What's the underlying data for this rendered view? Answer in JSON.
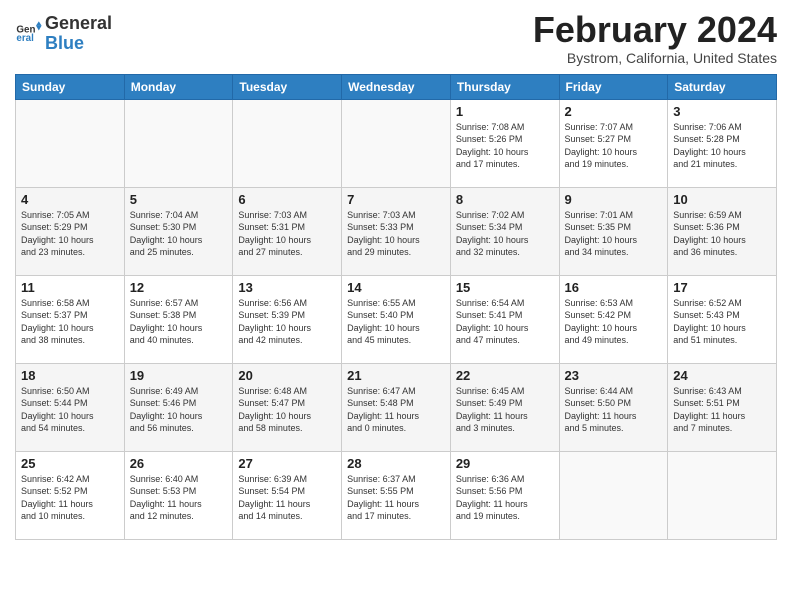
{
  "header": {
    "logo_general": "General",
    "logo_blue": "Blue",
    "month_title": "February 2024",
    "location": "Bystrom, California, United States"
  },
  "weekdays": [
    "Sunday",
    "Monday",
    "Tuesday",
    "Wednesday",
    "Thursday",
    "Friday",
    "Saturday"
  ],
  "weeks": [
    [
      {
        "day": "",
        "info": ""
      },
      {
        "day": "",
        "info": ""
      },
      {
        "day": "",
        "info": ""
      },
      {
        "day": "",
        "info": ""
      },
      {
        "day": "1",
        "info": "Sunrise: 7:08 AM\nSunset: 5:26 PM\nDaylight: 10 hours\nand 17 minutes."
      },
      {
        "day": "2",
        "info": "Sunrise: 7:07 AM\nSunset: 5:27 PM\nDaylight: 10 hours\nand 19 minutes."
      },
      {
        "day": "3",
        "info": "Sunrise: 7:06 AM\nSunset: 5:28 PM\nDaylight: 10 hours\nand 21 minutes."
      }
    ],
    [
      {
        "day": "4",
        "info": "Sunrise: 7:05 AM\nSunset: 5:29 PM\nDaylight: 10 hours\nand 23 minutes."
      },
      {
        "day": "5",
        "info": "Sunrise: 7:04 AM\nSunset: 5:30 PM\nDaylight: 10 hours\nand 25 minutes."
      },
      {
        "day": "6",
        "info": "Sunrise: 7:03 AM\nSunset: 5:31 PM\nDaylight: 10 hours\nand 27 minutes."
      },
      {
        "day": "7",
        "info": "Sunrise: 7:03 AM\nSunset: 5:33 PM\nDaylight: 10 hours\nand 29 minutes."
      },
      {
        "day": "8",
        "info": "Sunrise: 7:02 AM\nSunset: 5:34 PM\nDaylight: 10 hours\nand 32 minutes."
      },
      {
        "day": "9",
        "info": "Sunrise: 7:01 AM\nSunset: 5:35 PM\nDaylight: 10 hours\nand 34 minutes."
      },
      {
        "day": "10",
        "info": "Sunrise: 6:59 AM\nSunset: 5:36 PM\nDaylight: 10 hours\nand 36 minutes."
      }
    ],
    [
      {
        "day": "11",
        "info": "Sunrise: 6:58 AM\nSunset: 5:37 PM\nDaylight: 10 hours\nand 38 minutes."
      },
      {
        "day": "12",
        "info": "Sunrise: 6:57 AM\nSunset: 5:38 PM\nDaylight: 10 hours\nand 40 minutes."
      },
      {
        "day": "13",
        "info": "Sunrise: 6:56 AM\nSunset: 5:39 PM\nDaylight: 10 hours\nand 42 minutes."
      },
      {
        "day": "14",
        "info": "Sunrise: 6:55 AM\nSunset: 5:40 PM\nDaylight: 10 hours\nand 45 minutes."
      },
      {
        "day": "15",
        "info": "Sunrise: 6:54 AM\nSunset: 5:41 PM\nDaylight: 10 hours\nand 47 minutes."
      },
      {
        "day": "16",
        "info": "Sunrise: 6:53 AM\nSunset: 5:42 PM\nDaylight: 10 hours\nand 49 minutes."
      },
      {
        "day": "17",
        "info": "Sunrise: 6:52 AM\nSunset: 5:43 PM\nDaylight: 10 hours\nand 51 minutes."
      }
    ],
    [
      {
        "day": "18",
        "info": "Sunrise: 6:50 AM\nSunset: 5:44 PM\nDaylight: 10 hours\nand 54 minutes."
      },
      {
        "day": "19",
        "info": "Sunrise: 6:49 AM\nSunset: 5:46 PM\nDaylight: 10 hours\nand 56 minutes."
      },
      {
        "day": "20",
        "info": "Sunrise: 6:48 AM\nSunset: 5:47 PM\nDaylight: 10 hours\nand 58 minutes."
      },
      {
        "day": "21",
        "info": "Sunrise: 6:47 AM\nSunset: 5:48 PM\nDaylight: 11 hours\nand 0 minutes."
      },
      {
        "day": "22",
        "info": "Sunrise: 6:45 AM\nSunset: 5:49 PM\nDaylight: 11 hours\nand 3 minutes."
      },
      {
        "day": "23",
        "info": "Sunrise: 6:44 AM\nSunset: 5:50 PM\nDaylight: 11 hours\nand 5 minutes."
      },
      {
        "day": "24",
        "info": "Sunrise: 6:43 AM\nSunset: 5:51 PM\nDaylight: 11 hours\nand 7 minutes."
      }
    ],
    [
      {
        "day": "25",
        "info": "Sunrise: 6:42 AM\nSunset: 5:52 PM\nDaylight: 11 hours\nand 10 minutes."
      },
      {
        "day": "26",
        "info": "Sunrise: 6:40 AM\nSunset: 5:53 PM\nDaylight: 11 hours\nand 12 minutes."
      },
      {
        "day": "27",
        "info": "Sunrise: 6:39 AM\nSunset: 5:54 PM\nDaylight: 11 hours\nand 14 minutes."
      },
      {
        "day": "28",
        "info": "Sunrise: 6:37 AM\nSunset: 5:55 PM\nDaylight: 11 hours\nand 17 minutes."
      },
      {
        "day": "29",
        "info": "Sunrise: 6:36 AM\nSunset: 5:56 PM\nDaylight: 11 hours\nand 19 minutes."
      },
      {
        "day": "",
        "info": ""
      },
      {
        "day": "",
        "info": ""
      }
    ]
  ]
}
